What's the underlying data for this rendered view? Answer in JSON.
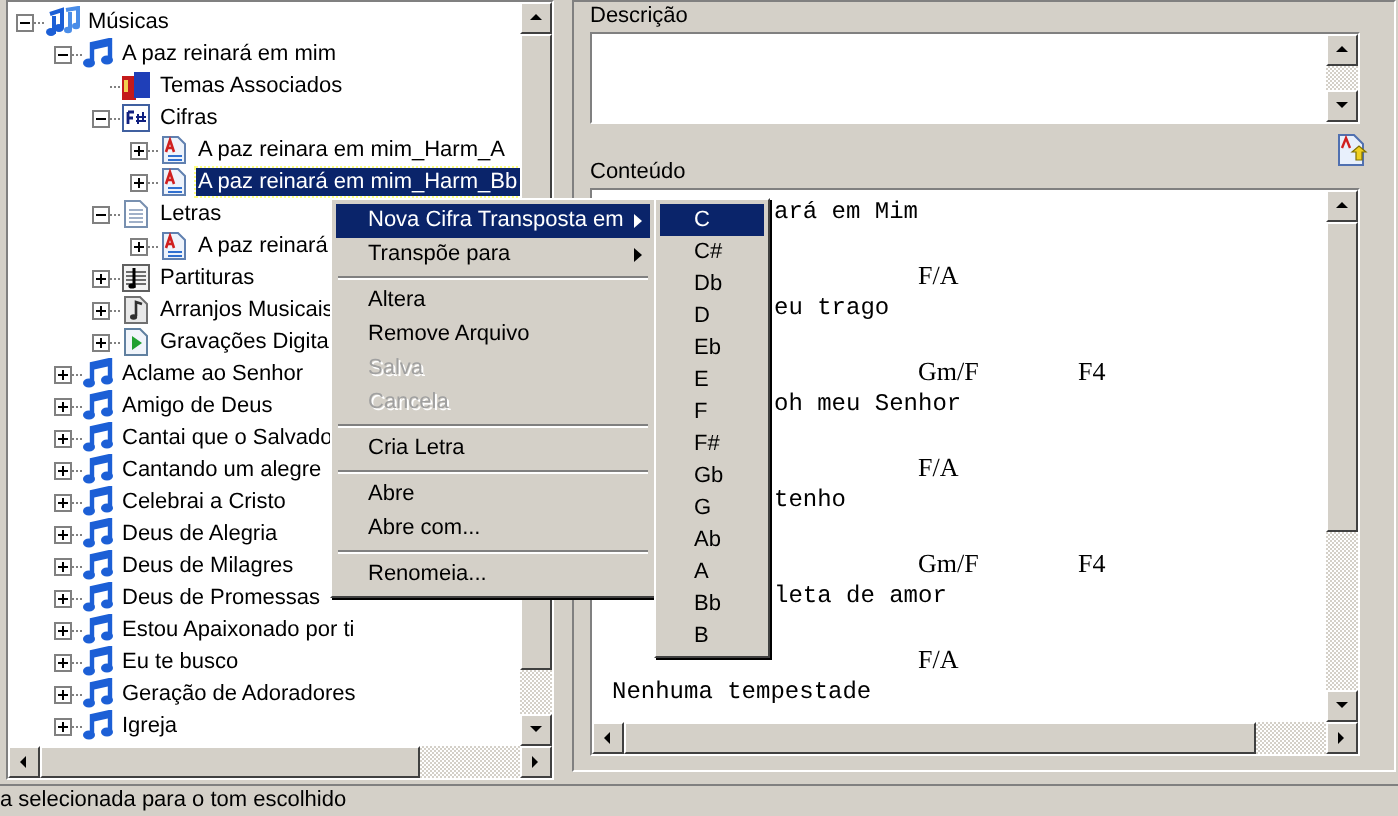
{
  "tree": {
    "items": [
      {
        "label": "Músicas",
        "kind": "music-folder",
        "expanded": true,
        "selected": false,
        "children": [
          {
            "label": "A paz reinará em mim",
            "kind": "song",
            "expanded": true,
            "selected": false,
            "children": [
              {
                "label": "Temas Associados",
                "kind": "book",
                "selected": false
              },
              {
                "label": "Cifras",
                "kind": "chords",
                "expanded": true,
                "selected": false,
                "children": [
                  {
                    "label": "A paz reinara em mim_Harm_A",
                    "kind": "doc-a",
                    "expanded": false,
                    "selected": false
                  },
                  {
                    "label": "A paz reinará em mim_Harm_Bb",
                    "kind": "doc-a",
                    "expanded": false,
                    "selected": true
                  }
                ]
              },
              {
                "label": "Letras",
                "kind": "doc",
                "expanded": true,
                "selected": false,
                "children": [
                  {
                    "label": "A paz reinará",
                    "kind": "doc-a",
                    "expanded": false,
                    "selected": false
                  }
                ]
              },
              {
                "label": "Partituras",
                "kind": "score",
                "expanded": false,
                "selected": false
              },
              {
                "label": "Arranjos Musicais",
                "kind": "arrangement",
                "expanded": false,
                "selected": false
              },
              {
                "label": "Gravações Digita",
                "kind": "recording",
                "expanded": false,
                "selected": false
              }
            ]
          },
          {
            "label": "Aclame ao Senhor",
            "kind": "song",
            "expanded": false,
            "selected": false
          },
          {
            "label": "Amigo de Deus",
            "kind": "song",
            "expanded": false,
            "selected": false
          },
          {
            "label": "Cantai que o Salvado",
            "kind": "song",
            "expanded": false,
            "selected": false
          },
          {
            "label": "Cantando um alegre",
            "kind": "song",
            "expanded": false,
            "selected": false
          },
          {
            "label": "Celebrai a Cristo",
            "kind": "song",
            "expanded": false,
            "selected": false
          },
          {
            "label": "Deus de Alegria",
            "kind": "song",
            "expanded": false,
            "selected": false
          },
          {
            "label": "Deus de Milagres",
            "kind": "song",
            "expanded": false,
            "selected": false
          },
          {
            "label": "Deus de Promessas",
            "kind": "song",
            "expanded": false,
            "selected": false
          },
          {
            "label": "Estou Apaixonado por ti",
            "kind": "song",
            "expanded": false,
            "selected": false
          },
          {
            "label": "Eu te busco",
            "kind": "song",
            "expanded": false,
            "selected": false
          },
          {
            "label": "Geração de Adoradores",
            "kind": "song",
            "expanded": false,
            "selected": false
          },
          {
            "label": "Igreja",
            "kind": "song",
            "expanded": false,
            "selected": false
          }
        ]
      }
    ]
  },
  "description": {
    "label": "Descrição"
  },
  "content": {
    "label": "Conteúdo",
    "lines": [
      {
        "kind": "tail",
        "text": "ará em Mim"
      },
      {
        "kind": "blank"
      },
      {
        "kind": "chord",
        "chords": [
          "F/A"
        ]
      },
      {
        "kind": "tail",
        "text": "eu trago"
      },
      {
        "kind": "blank"
      },
      {
        "kind": "chord",
        "chords": [
          "Gm/F",
          "F4"
        ]
      },
      {
        "kind": "tail",
        "text": "oh meu Senhor"
      },
      {
        "kind": "blank"
      },
      {
        "kind": "chord",
        "chords": [
          "F/A"
        ]
      },
      {
        "kind": "tail",
        "text": "tenho"
      },
      {
        "kind": "blank"
      },
      {
        "kind": "chord",
        "chords": [
          "Gm/F",
          "F4"
        ]
      },
      {
        "kind": "tail",
        "text": "leta de amor"
      },
      {
        "kind": "blank"
      },
      {
        "kind": "chord",
        "chords": [
          "F/A"
        ]
      },
      {
        "kind": "lyric",
        "text": "Nenhuma tempestade"
      }
    ]
  },
  "context_menu": {
    "items": [
      {
        "kind": "item",
        "label": "Nova Cifra Transposta em",
        "submenu": true,
        "selected": true,
        "disabled": false
      },
      {
        "kind": "item",
        "label": "Transpõe para",
        "submenu": true,
        "selected": false,
        "disabled": false
      },
      {
        "kind": "separator"
      },
      {
        "kind": "item",
        "label": "Altera",
        "submenu": false,
        "selected": false,
        "disabled": false
      },
      {
        "kind": "item",
        "label": "Remove Arquivo",
        "submenu": false,
        "selected": false,
        "disabled": false
      },
      {
        "kind": "item",
        "label": "Salva",
        "submenu": false,
        "selected": false,
        "disabled": true
      },
      {
        "kind": "item",
        "label": "Cancela",
        "submenu": false,
        "selected": false,
        "disabled": true
      },
      {
        "kind": "separator"
      },
      {
        "kind": "item",
        "label": "Cria Letra",
        "submenu": false,
        "selected": false,
        "disabled": false
      },
      {
        "kind": "separator"
      },
      {
        "kind": "item",
        "label": "Abre",
        "submenu": false,
        "selected": false,
        "disabled": false
      },
      {
        "kind": "item",
        "label": "Abre com...",
        "submenu": false,
        "selected": false,
        "disabled": false
      },
      {
        "kind": "separator"
      },
      {
        "kind": "item",
        "label": "Renomeia...",
        "submenu": false,
        "selected": false,
        "disabled": false
      }
    ]
  },
  "submenu": {
    "items": [
      {
        "label": "C",
        "selected": true
      },
      {
        "label": "C#",
        "selected": false
      },
      {
        "label": "Db",
        "selected": false
      },
      {
        "label": "D",
        "selected": false
      },
      {
        "label": "Eb",
        "selected": false
      },
      {
        "label": "E",
        "selected": false
      },
      {
        "label": "F",
        "selected": false
      },
      {
        "label": "F#",
        "selected": false
      },
      {
        "label": "Gb",
        "selected": false
      },
      {
        "label": "G",
        "selected": false
      },
      {
        "label": "Ab",
        "selected": false
      },
      {
        "label": "A",
        "selected": false
      },
      {
        "label": "Bb",
        "selected": false
      },
      {
        "label": "B",
        "selected": false
      }
    ]
  },
  "status_bar": {
    "text": "a selecionada para o tom escolhido"
  }
}
